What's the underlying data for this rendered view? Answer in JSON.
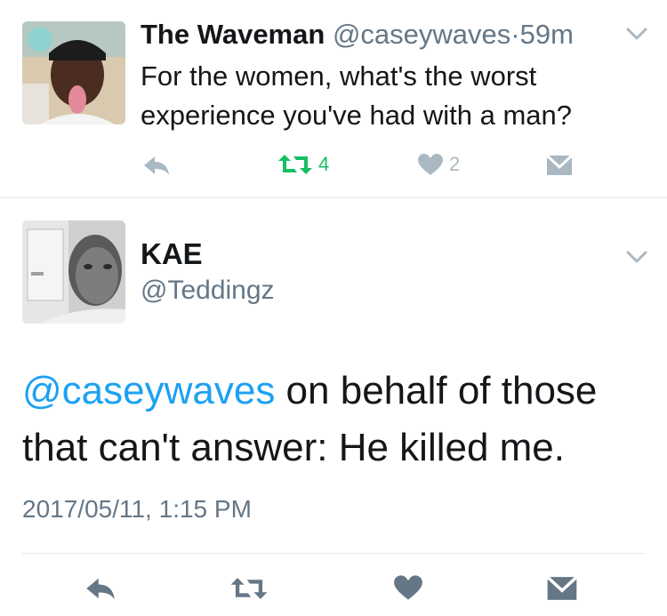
{
  "tweet1": {
    "name": "The Waveman",
    "handle": "@caseywaves",
    "separator": "·",
    "time": "59m",
    "text": "For the women, what's the worst experience you've had with a man?",
    "retweet_count": "4",
    "like_count": "2",
    "colors": {
      "retweet_active": "#17bf63",
      "icon_gray": "#aab8c2"
    }
  },
  "tweet2": {
    "name": "KAE",
    "handle": "@Teddingz",
    "mention": "@caseywaves",
    "text": " on behalf of those that can't answer: He killed me.",
    "date": "2017/05/11, 1:15 PM",
    "colors": {
      "mention": "#1da1f2",
      "icon_gray": "#657786"
    }
  }
}
